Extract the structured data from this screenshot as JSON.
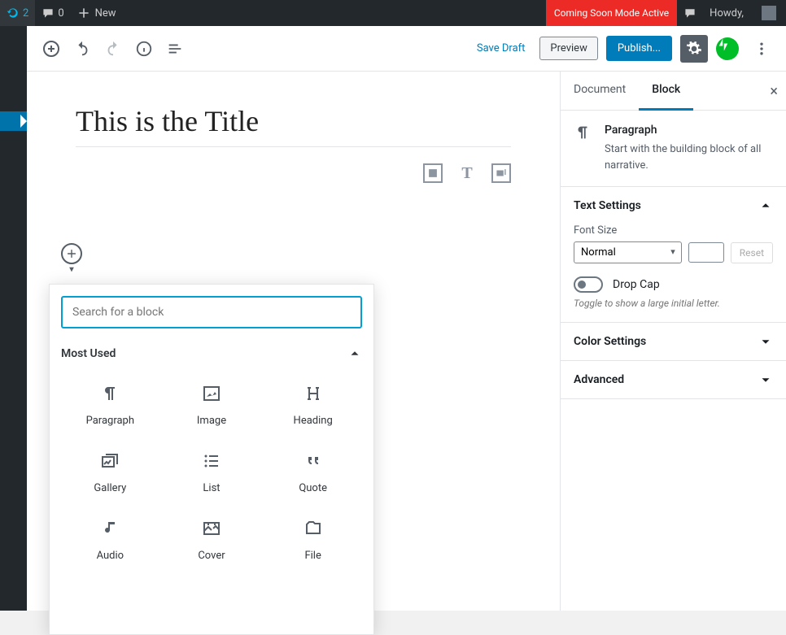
{
  "adminbar": {
    "refresh_count": "2",
    "comments_count": "0",
    "new_label": "New",
    "coming_soon": "Coming Soon Mode Active",
    "howdy": "Howdy,"
  },
  "toolbar": {
    "save_draft": "Save Draft",
    "preview": "Preview",
    "publish": "Publish..."
  },
  "content": {
    "title": "This is the Title"
  },
  "inserter": {
    "search_placeholder": "Search for a block",
    "category": "Most Used",
    "items": [
      {
        "label": "Paragraph",
        "icon": "paragraph"
      },
      {
        "label": "Image",
        "icon": "image"
      },
      {
        "label": "Heading",
        "icon": "heading"
      },
      {
        "label": "Gallery",
        "icon": "gallery"
      },
      {
        "label": "List",
        "icon": "list"
      },
      {
        "label": "Quote",
        "icon": "quote"
      },
      {
        "label": "Audio",
        "icon": "audio"
      },
      {
        "label": "Cover",
        "icon": "cover"
      },
      {
        "label": "File",
        "icon": "file"
      }
    ]
  },
  "sidebar": {
    "tabs": {
      "document": "Document",
      "block": "Block"
    },
    "block_name": "Paragraph",
    "block_desc": "Start with the building block of all narrative.",
    "panels": {
      "text_settings": "Text Settings",
      "font_size_label": "Font Size",
      "font_size_value": "Normal",
      "reset": "Reset",
      "drop_cap": "Drop Cap",
      "drop_cap_help": "Toggle to show a large initial letter.",
      "color_settings": "Color Settings",
      "advanced": "Advanced"
    }
  }
}
